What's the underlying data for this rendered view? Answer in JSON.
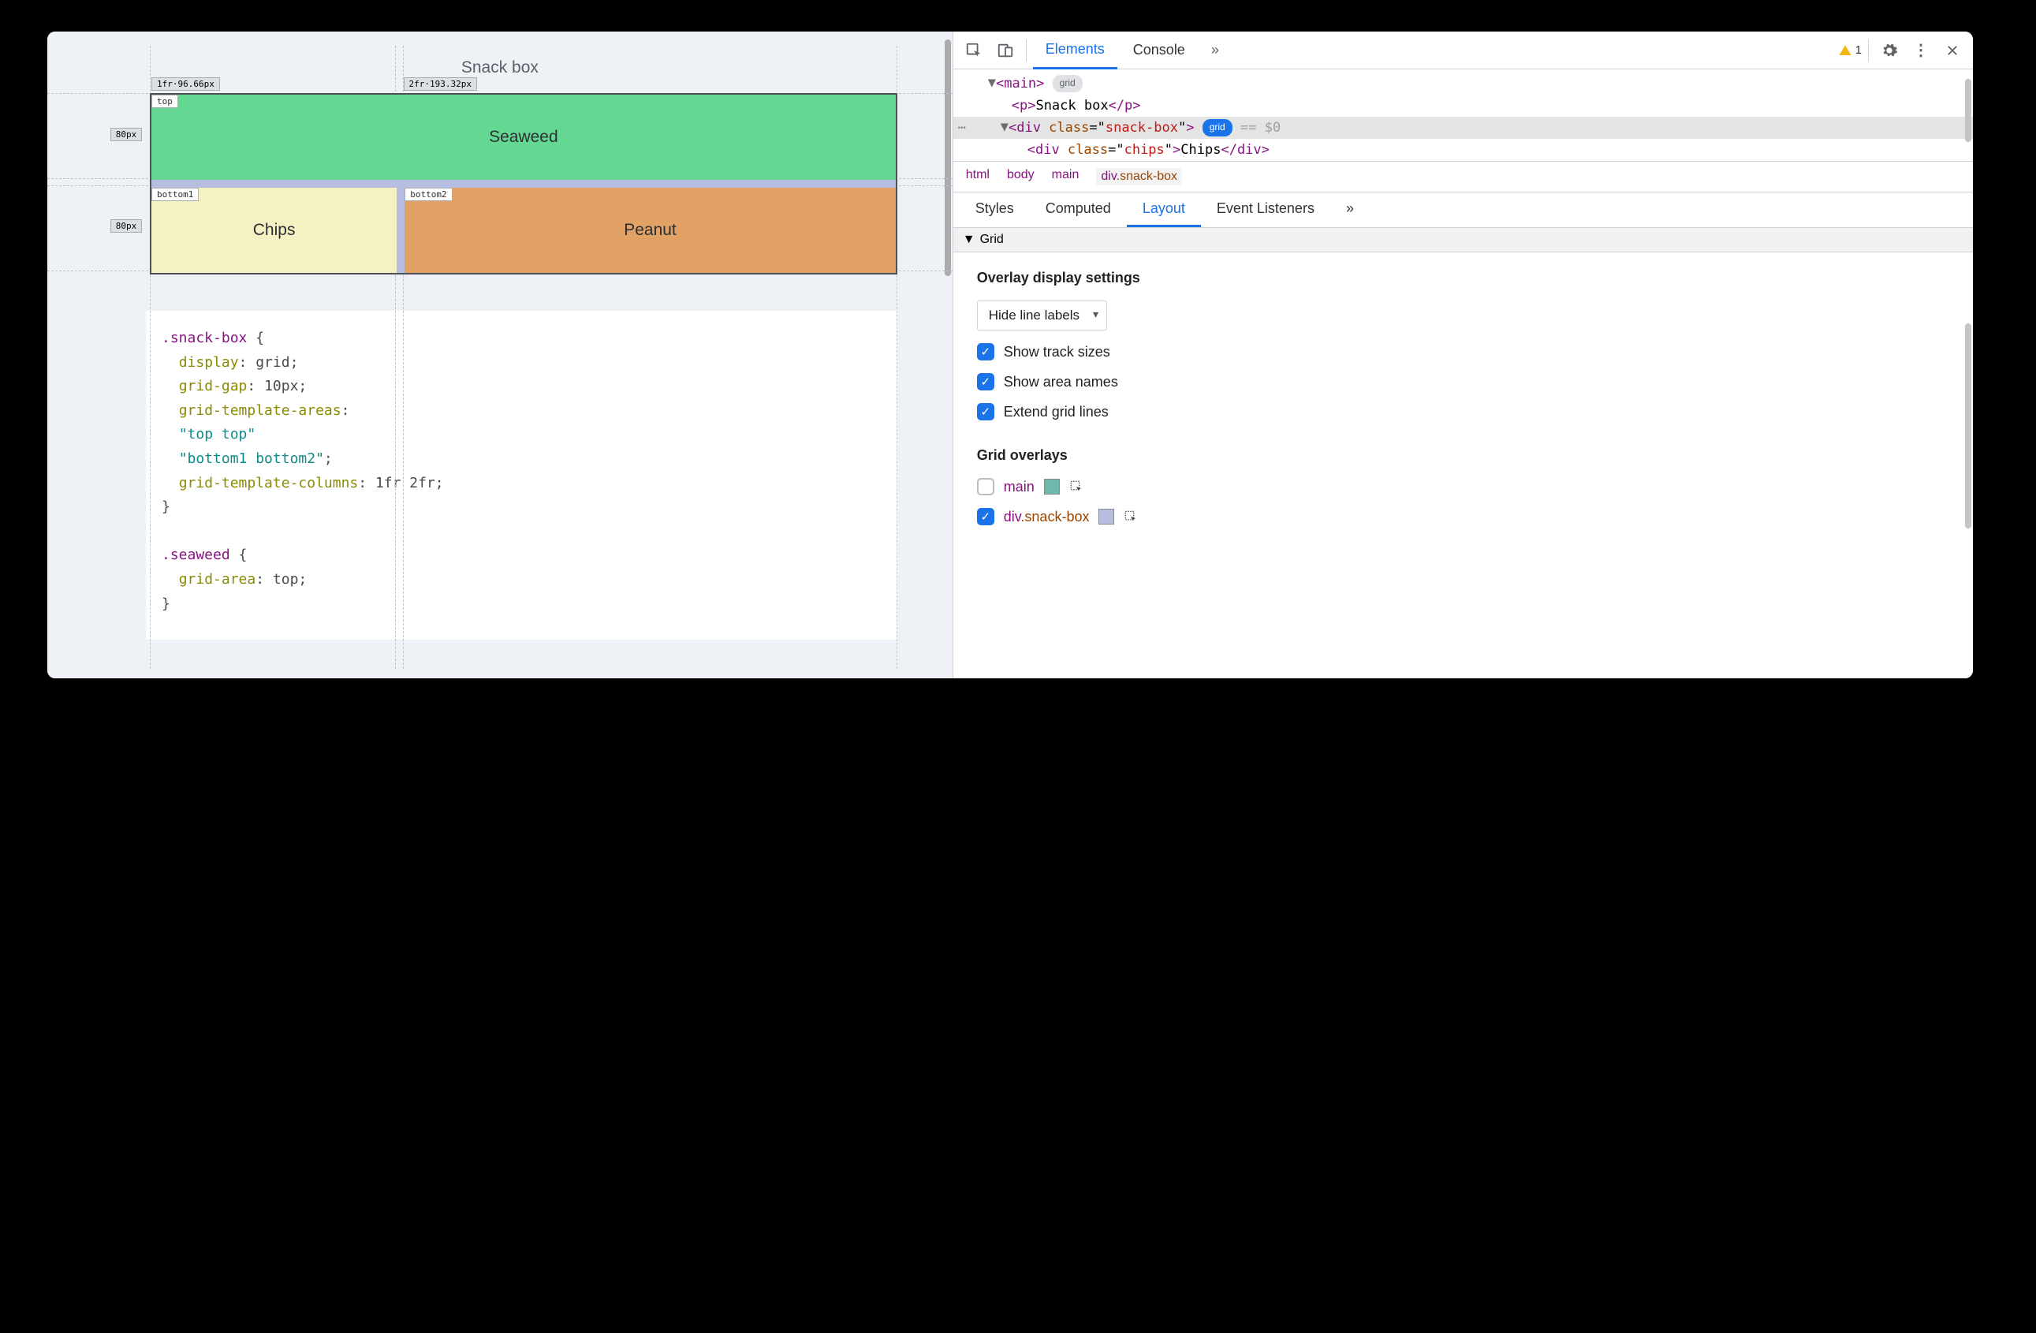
{
  "page": {
    "title": "Snack box",
    "grid": {
      "col_label_1": "1fr·96.66px",
      "col_label_2": "2fr·193.32px",
      "row_label_1": "80px",
      "row_label_2": "80px",
      "area_top": "top",
      "area_b1": "bottom1",
      "area_b2": "bottom2",
      "seaweed": "Seaweed",
      "chips": "Chips",
      "peanut": "Peanut"
    },
    "css": ".snack-box {\n  display: grid;\n  grid-gap: 10px;\n  grid-template-areas:\n  \"top top\"\n  \"bottom1 bottom2\";\n  grid-template-columns: 1fr 2fr;\n}\n\n.seaweed {\n  grid-area: top;\n}"
  },
  "toolbar": {
    "tab_elements": "Elements",
    "tab_console": "Console",
    "warn_count": "1"
  },
  "dom": {
    "main_open": "<main>",
    "main_badge": "grid",
    "p_line": "<p>Snack box</p>",
    "snack_open_prefix": "<div ",
    "snack_attr_name": "class",
    "snack_attr_val": "snack-box",
    "grid_badge": "grid",
    "eq0": "== $0",
    "chips_line_prefix": "<div ",
    "chips_attr_name": "class",
    "chips_attr_val": "chips",
    "chips_text": "Chips",
    "chips_close": "</div>"
  },
  "breadcrumb": {
    "html": "html",
    "body": "body",
    "main": "main",
    "div": "div",
    "div_cls": ".snack-box"
  },
  "subtabs": {
    "styles": "Styles",
    "computed": "Computed",
    "layout": "Layout",
    "events": "Event Listeners"
  },
  "layout": {
    "section": "Grid",
    "overlay_hdr": "Overlay display settings",
    "select": "Hide line labels",
    "chk_tracks": "Show track sizes",
    "chk_areas": "Show area names",
    "chk_extend": "Extend grid lines",
    "overlays_hdr": "Grid overlays",
    "ov_main": "main",
    "ov_snack": "div.snack-box"
  }
}
